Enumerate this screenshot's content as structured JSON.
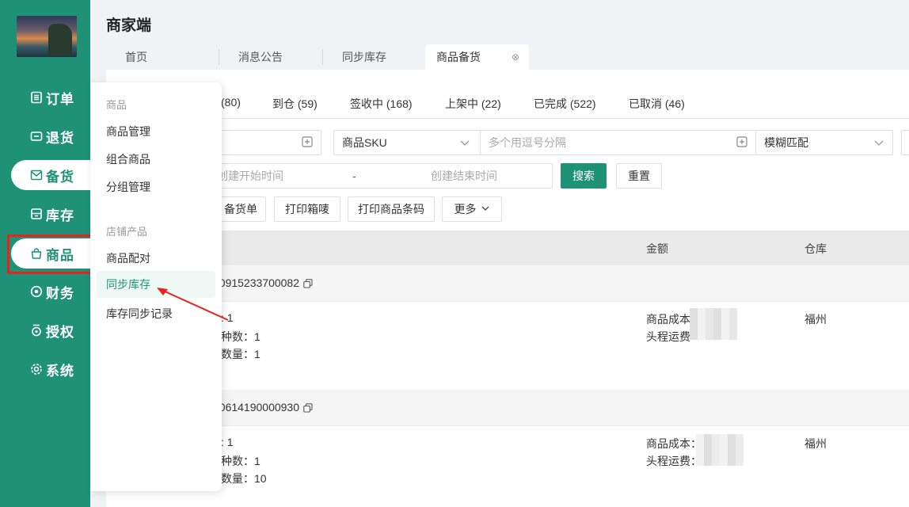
{
  "app": {
    "title": "商家端"
  },
  "sidebar": {
    "items": [
      {
        "label": "订单",
        "icon": "list-icon"
      },
      {
        "label": "退货",
        "icon": "return-box-icon"
      },
      {
        "label": "备货",
        "icon": "mail-icon"
      },
      {
        "label": "库存",
        "icon": "inventory-icon"
      },
      {
        "label": "商品",
        "icon": "shopping-bag-icon"
      },
      {
        "label": "财务",
        "icon": "finance-icon"
      },
      {
        "label": "授权",
        "icon": "badge-icon"
      },
      {
        "label": "系统",
        "icon": "gear-icon"
      }
    ]
  },
  "tabs": [
    {
      "label": "首页"
    },
    {
      "label": "消息公告"
    },
    {
      "label": "同步库存"
    },
    {
      "label": "商品备货",
      "close": "⊗"
    }
  ],
  "status_tabs": [
    {
      "label": "(80)"
    },
    {
      "label": "到仓 (59)"
    },
    {
      "label": "签收中 (168)"
    },
    {
      "label": "上架中 (22)"
    },
    {
      "label": "已完成 (522)"
    },
    {
      "label": "已取消 (46)"
    }
  ],
  "filters": {
    "sku_select": "商品SKU",
    "sku_placeholder": "多个用逗号分隔",
    "match_select": "模糊匹配",
    "start_time_placeholder": "创建开始时间",
    "range_sep": "-",
    "end_time_placeholder": "创建结束时间",
    "search_label": "搜索",
    "reset_label": "重置"
  },
  "actions": {
    "print_order": "备货单",
    "print_box": "打印箱唛",
    "print_barcode": "打印商品条码",
    "more": "更多"
  },
  "table": {
    "headers": {
      "amount": "金额",
      "warehouse": "仓库"
    },
    "orders": [
      {
        "order_no": "60915233700082",
        "line1": ": 1",
        "line2": "种数：1",
        "line3": "数量：1",
        "cost_label": "商品成本",
        "freight_label": "头程运费",
        "warehouse": "福州"
      },
      {
        "order_no": "60614190000930",
        "line1": ": 1",
        "line2": "种数：1",
        "line3": "数量：10",
        "cost_label": "商品成本：",
        "freight_label": "头程运费：",
        "warehouse": "福州"
      }
    ]
  },
  "dropdown": {
    "group1": "商品",
    "items1": [
      "商品管理",
      "组合商品",
      "分组管理"
    ],
    "group2": "店铺产品",
    "items2": [
      "商品配对",
      "同步库存",
      "库存同步记录"
    ]
  },
  "colors": {
    "brand": "#1f9177",
    "highlight_box": "#e8231f"
  }
}
